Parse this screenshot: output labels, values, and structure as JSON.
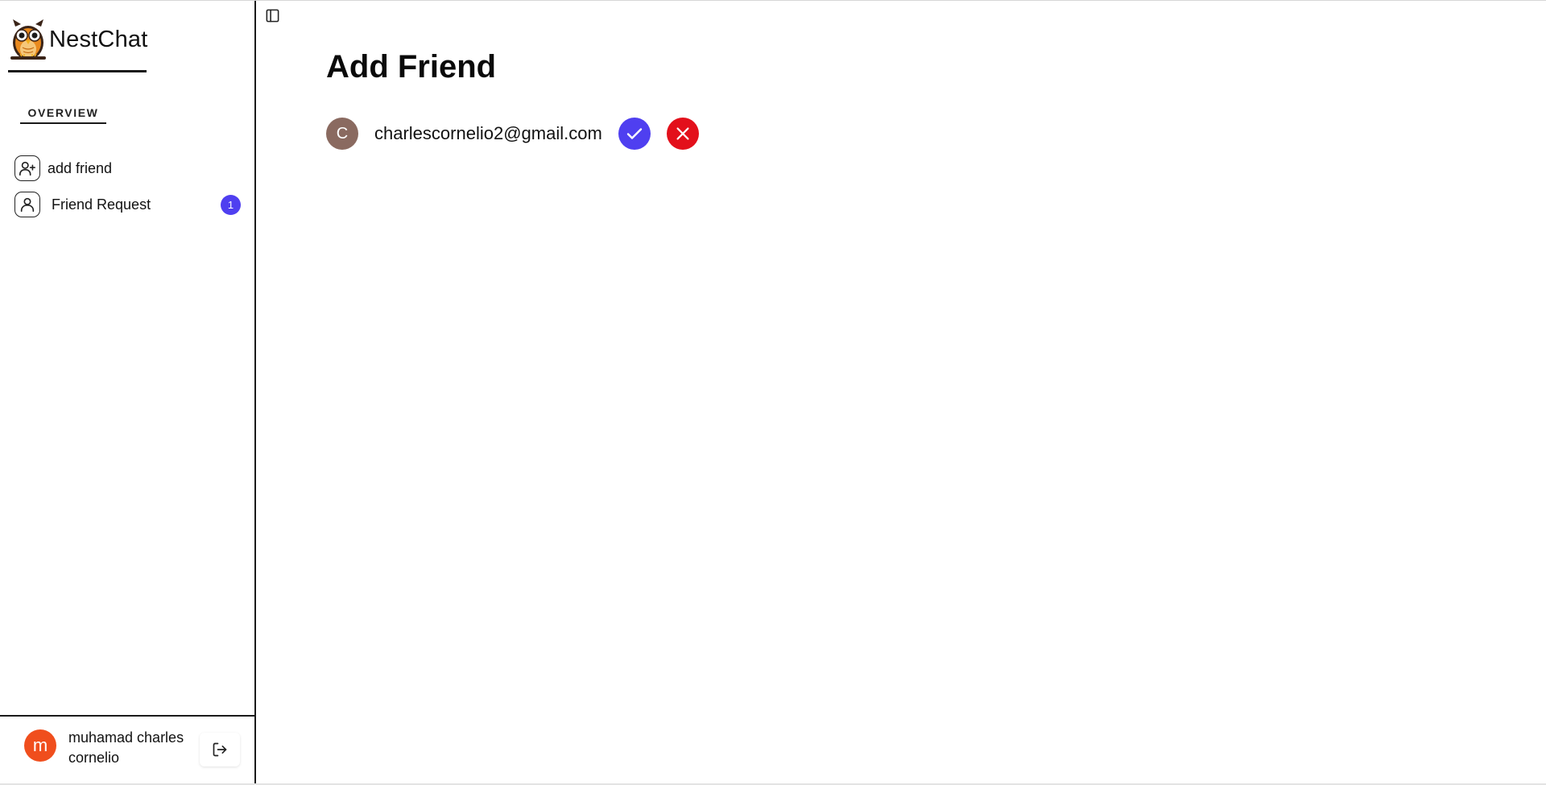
{
  "app": {
    "name": "NestChat",
    "logo_icon": "owl-logo-icon"
  },
  "sidebar": {
    "section_label": "OVERVIEW",
    "items": [
      {
        "label": "add friend",
        "icon": "user-plus-icon"
      },
      {
        "label": "Friend Request",
        "icon": "user-icon",
        "badge": "1"
      }
    ],
    "user": {
      "initial": "m",
      "name": "muhamad charles cornelio",
      "avatar_color": "#f04e1d"
    },
    "logout_icon": "logout-icon"
  },
  "main": {
    "toggle_icon": "sidebar-toggle-icon",
    "title": "Add Friend",
    "requests": [
      {
        "initial": "C",
        "email": "charlescornelio2@gmail.com",
        "avatar_color": "#8a6a60"
      }
    ],
    "accept_icon": "check-icon",
    "deny_icon": "close-icon"
  },
  "colors": {
    "accent": "#4f3ff0",
    "danger": "#e3101b"
  }
}
